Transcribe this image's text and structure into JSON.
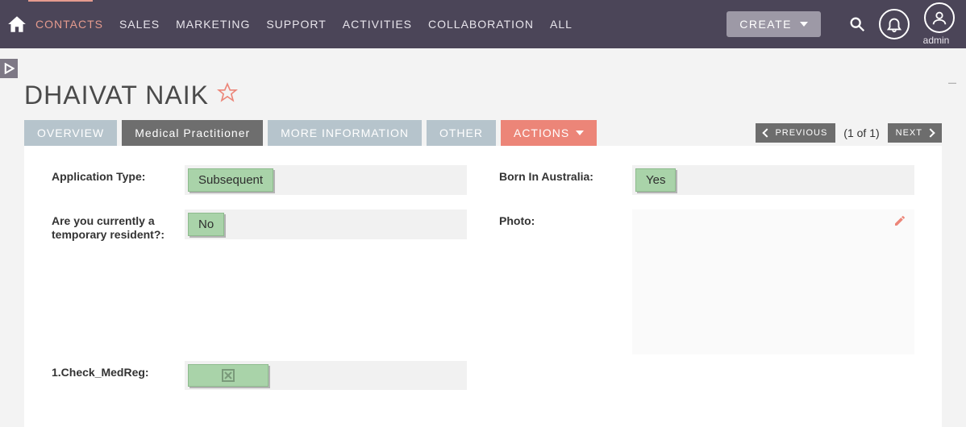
{
  "accent_color": "#ec8578",
  "topbar": {
    "nav": [
      "CONTACTS",
      "SALES",
      "MARKETING",
      "SUPPORT",
      "ACTIVITIES",
      "COLLABORATION",
      "ALL"
    ],
    "active_nav_index": 0,
    "create_label": "CREATE",
    "user_label": "admin"
  },
  "page": {
    "title": "DHAIVAT NAIK"
  },
  "tabs": {
    "items": [
      "OVERVIEW",
      "Medical Practitioner",
      "MORE INFORMATION",
      "OTHER"
    ],
    "selected_index": 1,
    "actions_label": "ACTIONS"
  },
  "pager": {
    "prev_label": "PREVIOUS",
    "count_label": "(1 of 1)",
    "next_label": "NEXT"
  },
  "fields": {
    "application_type": {
      "label": "Application Type:",
      "value": "Subsequent"
    },
    "temporary_resident": {
      "label": "Are you currently a temporary resident?:",
      "value": "No"
    },
    "check_medreg": {
      "label": "1.Check_MedReg:"
    },
    "born_in_australia": {
      "label": "Born In Australia:",
      "value": "Yes"
    },
    "photo": {
      "label": "Photo:"
    }
  }
}
